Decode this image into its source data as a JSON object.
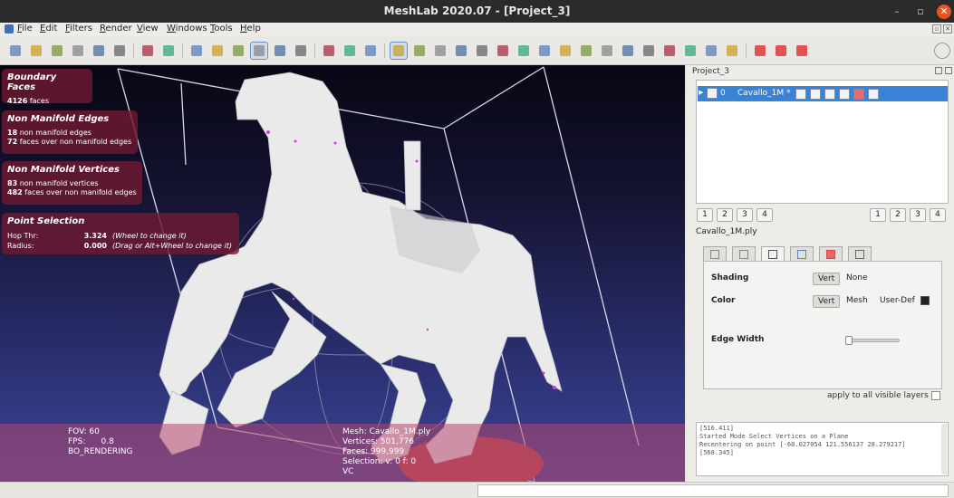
{
  "window": {
    "title": "MeshLab 2020.07 - [Project_3]",
    "controls": [
      "minimize-icon",
      "maximize-icon",
      "close-icon"
    ]
  },
  "menu": {
    "items": [
      "File",
      "Edit",
      "Filters",
      "Render",
      "View",
      "Windows",
      "Tools",
      "Help"
    ]
  },
  "toolbar": {
    "groups": [
      [
        "new-project-icon",
        "open-project-icon",
        "open-mesh-icon",
        "reload-icon",
        "export-mesh-icon",
        "snapshot-icon"
      ],
      [
        "layers-icon",
        "align-icon"
      ],
      [
        "bbox-icon",
        "points-icon",
        "wireframe-icon",
        "flat-icon",
        "smooth-icon",
        "texture-icon"
      ],
      [
        "fit-icon",
        "light-icon",
        "perspective-icon"
      ],
      [
        "select-vertices-icon",
        "annotate-icon",
        "measure-icon",
        "paint-icon",
        "move-icon",
        "rotate-icon",
        "brush-icon",
        "info-icon",
        "pick-icon",
        "align-edit-icon",
        "camera-icon",
        "cut-icon",
        "texture-edit-icon",
        "paintbrush-icon",
        "select-faces-icon",
        "select-connected-icon",
        "shape-icon"
      ],
      [
        "delete-vertices-icon",
        "delete-faces-icon",
        "delete-all-icon"
      ]
    ],
    "search_icon": "search-icon"
  },
  "overlays": {
    "boundary_faces": {
      "title": "Boundary Faces",
      "count": "4126",
      "label": "faces"
    },
    "non_manifold_edges": {
      "title": "Non Manifold Edges",
      "edges_count": "18",
      "edges_label": "non manifold edges",
      "faces_count": "72",
      "faces_label": "faces over non manifold edges"
    },
    "non_manifold_vertices": {
      "title": "Non Manifold Vertices",
      "vertices_count": "83",
      "vertices_label": "non manifold vertices",
      "faces_count": "482",
      "faces_label": "faces over non manifold edges"
    },
    "point_selection": {
      "title": "Point Selection",
      "hop_label": "Hop Thr:",
      "hop_value": "3.324",
      "hop_note": "(Wheel to change it)",
      "radius_label": "Radius:",
      "radius_value": "0.000",
      "radius_note": "(Drag or Alt+Wheel to change it)"
    }
  },
  "viewport_info": {
    "fov": "FOV: 60",
    "fps": "FPS:      0.8",
    "rendering": "BO_RENDERING",
    "mesh": "Mesh: Cavallo_1M.ply",
    "vertices": "Vertices: 501,776",
    "faces": "Faces: 999,999",
    "selection": "Selection: v: 0 f: 0",
    "vc": "VC"
  },
  "project_panel": {
    "title": "Project_3",
    "layer": {
      "index": "0",
      "name": "Cavallo_1M *"
    },
    "left_buttons": [
      "1",
      "2",
      "3",
      "4"
    ],
    "right_buttons": [
      "1",
      "2",
      "3",
      "4"
    ],
    "filename": "Cavallo_1M.ply",
    "tabs": [
      "box-tab-icon",
      "points-tab-icon",
      "wire-tab-icon",
      "flat-tab-icon",
      "texture-tab-icon",
      "solid-tab-icon"
    ],
    "shading": {
      "label": "Shading",
      "opt1": "Vert",
      "opt2": "None"
    },
    "color": {
      "label": "Color",
      "opt1": "Vert",
      "opt2": "Mesh",
      "opt3": "User-Def",
      "swatch": "#222222"
    },
    "edge_width": {
      "label": "Edge Width",
      "value": 0
    },
    "apply_label": "apply to all visible layers"
  },
  "log": {
    "lines": [
      "[516.411]",
      "Started Mode Select Vertices on a Plane",
      "Recentering on point [-60.027054 121.556137 28.279217]",
      "[568.345]"
    ]
  },
  "colors": {
    "accent": "#3a82d6",
    "close_button": "#e95420",
    "overlay": "#6e1a32"
  }
}
